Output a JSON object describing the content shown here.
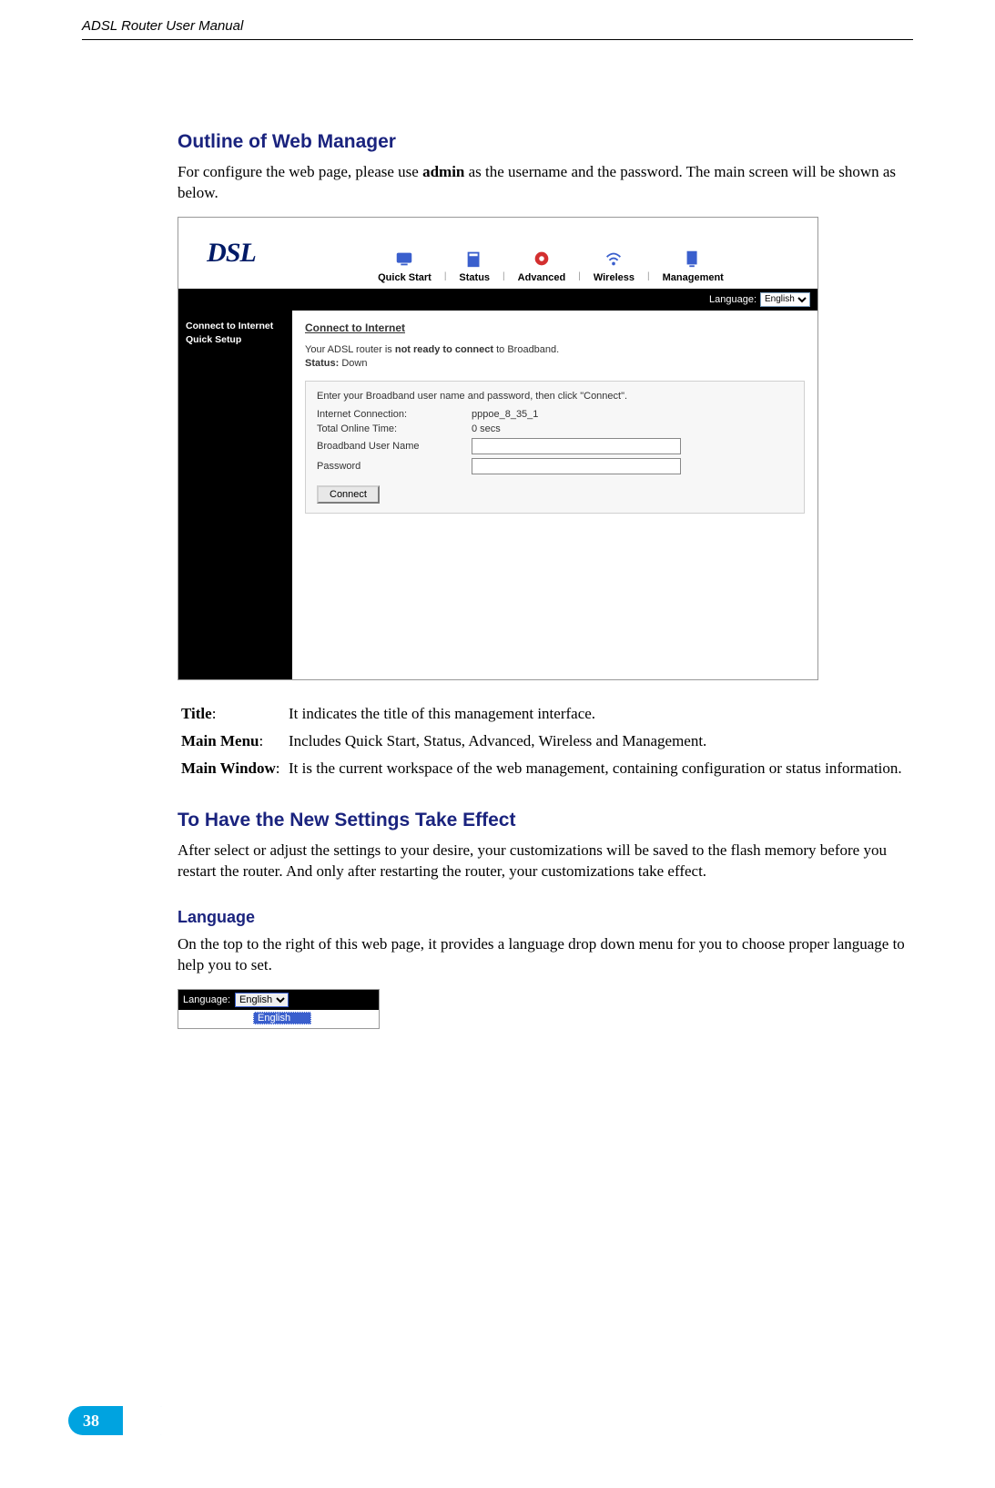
{
  "header": {
    "title": "ADSL Router User Manual"
  },
  "section1": {
    "heading": "Outline of Web Manager",
    "intro_prefix": "For configure the web page, please use ",
    "intro_bold": "admin",
    "intro_suffix": " as the username and the password. The main screen will be shown as below."
  },
  "router": {
    "logo": "DSL",
    "nav": {
      "quick_start": "Quick Start",
      "status": "Status",
      "advanced": "Advanced",
      "wireless": "Wireless",
      "management": "Management"
    },
    "language_label": "Language:",
    "language_value": "English",
    "sidebar": {
      "line1": "Connect to Internet",
      "line2": "Quick Setup"
    },
    "panel": {
      "title": "Connect to Internet",
      "msg_prefix": "Your ADSL router is ",
      "msg_bold": "not ready to connect",
      "msg_suffix": " to Broadband.",
      "status_label": "Status:",
      "status_value": "Down",
      "config": {
        "instruction": "Enter your Broadband user name and password, then click \"Connect\".",
        "internet_conn_label": "Internet Connection:",
        "internet_conn_value": "pppoe_8_35_1",
        "online_time_label": "Total Online Time:",
        "online_time_value": "0 secs",
        "username_label": "Broadband User Name",
        "password_label": "Password",
        "connect_btn": "Connect"
      }
    }
  },
  "definitions": {
    "title_term": "Title",
    "title_desc": "It indicates the title of this management interface.",
    "menu_term": "Main Menu",
    "menu_desc": "Includes Quick Start, Status, Advanced, Wireless and Management.",
    "window_term": "Main Window",
    "window_desc": "It is the current workspace of the web management, containing configuration or status information."
  },
  "section2": {
    "heading": "To Have the New Settings Take Effect",
    "body": "After select or adjust the settings to your desire, your customizations will be saved to the flash memory before you restart the router. And only after restarting the router, your customizations take effect."
  },
  "section3": {
    "heading": "Language",
    "body": "On the top to the right of this web page, it provides a language drop down menu for you to choose proper language to help you to set.",
    "dropdown": {
      "label": "Language:",
      "value": "English",
      "option": "English"
    }
  },
  "page_number": "38",
  "colon": ":"
}
